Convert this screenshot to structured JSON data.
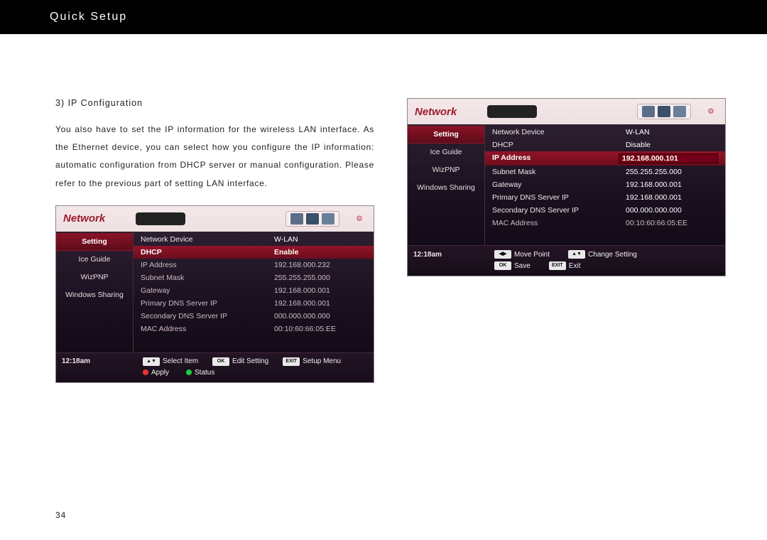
{
  "page_title": "Quick Setup",
  "section": {
    "heading": "3) IP Configuration"
  },
  "paragraph": "You also have to set the IP information for the wireless LAN interface. As the Ethernet device, you can select how you configure the IP information: automatic configuration from DHCP server or manual configuration. Please refer to the previous part of setting LAN interface.",
  "page_number": "34",
  "shot_header_title": "Network",
  "sidebar_items": [
    "Setting",
    "Ice Guide",
    "WizPNP",
    "Windows Sharing"
  ],
  "screenshot1": {
    "rows": [
      {
        "key": "Network Device",
        "val": "W-LAN",
        "style": "plain"
      },
      {
        "key": "DHCP",
        "val": "Enable",
        "style": "hl"
      },
      {
        "key": "IP Address",
        "val": "192.168.000.232",
        "style": "dim"
      },
      {
        "key": "Subnet Mask",
        "val": "255.255.255.000",
        "style": "dim"
      },
      {
        "key": "Gateway",
        "val": "192.168.000.001",
        "style": "dim"
      },
      {
        "key": "Primary DNS Server IP",
        "val": "192.168.000.001",
        "style": "dim"
      },
      {
        "key": "Secondary DNS Server IP",
        "val": "000.000.000.000",
        "style": "dim"
      },
      {
        "key": "MAC Address",
        "val": "00:10:60:66:05:EE",
        "style": "dim"
      }
    ],
    "time": "12:18am",
    "foot1": [
      {
        "icon": "▲▼",
        "label": "Select Item"
      },
      {
        "icon": "OK",
        "label": "Edit Setting"
      },
      {
        "icon": "EXIT",
        "label": "Setup Menu"
      }
    ],
    "foot2": [
      {
        "dot": "red",
        "label": "Apply"
      },
      {
        "dot": "green",
        "label": "Status"
      }
    ]
  },
  "screenshot2": {
    "rows": [
      {
        "key": "Network Device",
        "val": "W-LAN",
        "style": "plain"
      },
      {
        "key": "DHCP",
        "val": "Disable",
        "style": "plain"
      },
      {
        "key": "IP Address",
        "val": "192.168.000.101",
        "style": "hl edit"
      },
      {
        "key": "Subnet Mask",
        "val": "255.255.255.000",
        "style": "plain"
      },
      {
        "key": "Gateway",
        "val": "192.168.000.001",
        "style": "plain"
      },
      {
        "key": "Primary DNS Server IP",
        "val": "192.168.000.001",
        "style": "plain"
      },
      {
        "key": "Secondary DNS Server IP",
        "val": "000.000.000.000",
        "style": "plain"
      },
      {
        "key": "MAC Address",
        "val": "00:10:60:66:05:EE",
        "style": "dim"
      }
    ],
    "time": "12:18am",
    "foot1": [
      {
        "icon": "◀▶",
        "label": "Move Point"
      },
      {
        "icon": "▲▼",
        "label": "Change Setting"
      }
    ],
    "foot2": [
      {
        "icon": "OK",
        "label": "Save"
      },
      {
        "icon": "EXIT",
        "label": "Exit"
      }
    ]
  }
}
